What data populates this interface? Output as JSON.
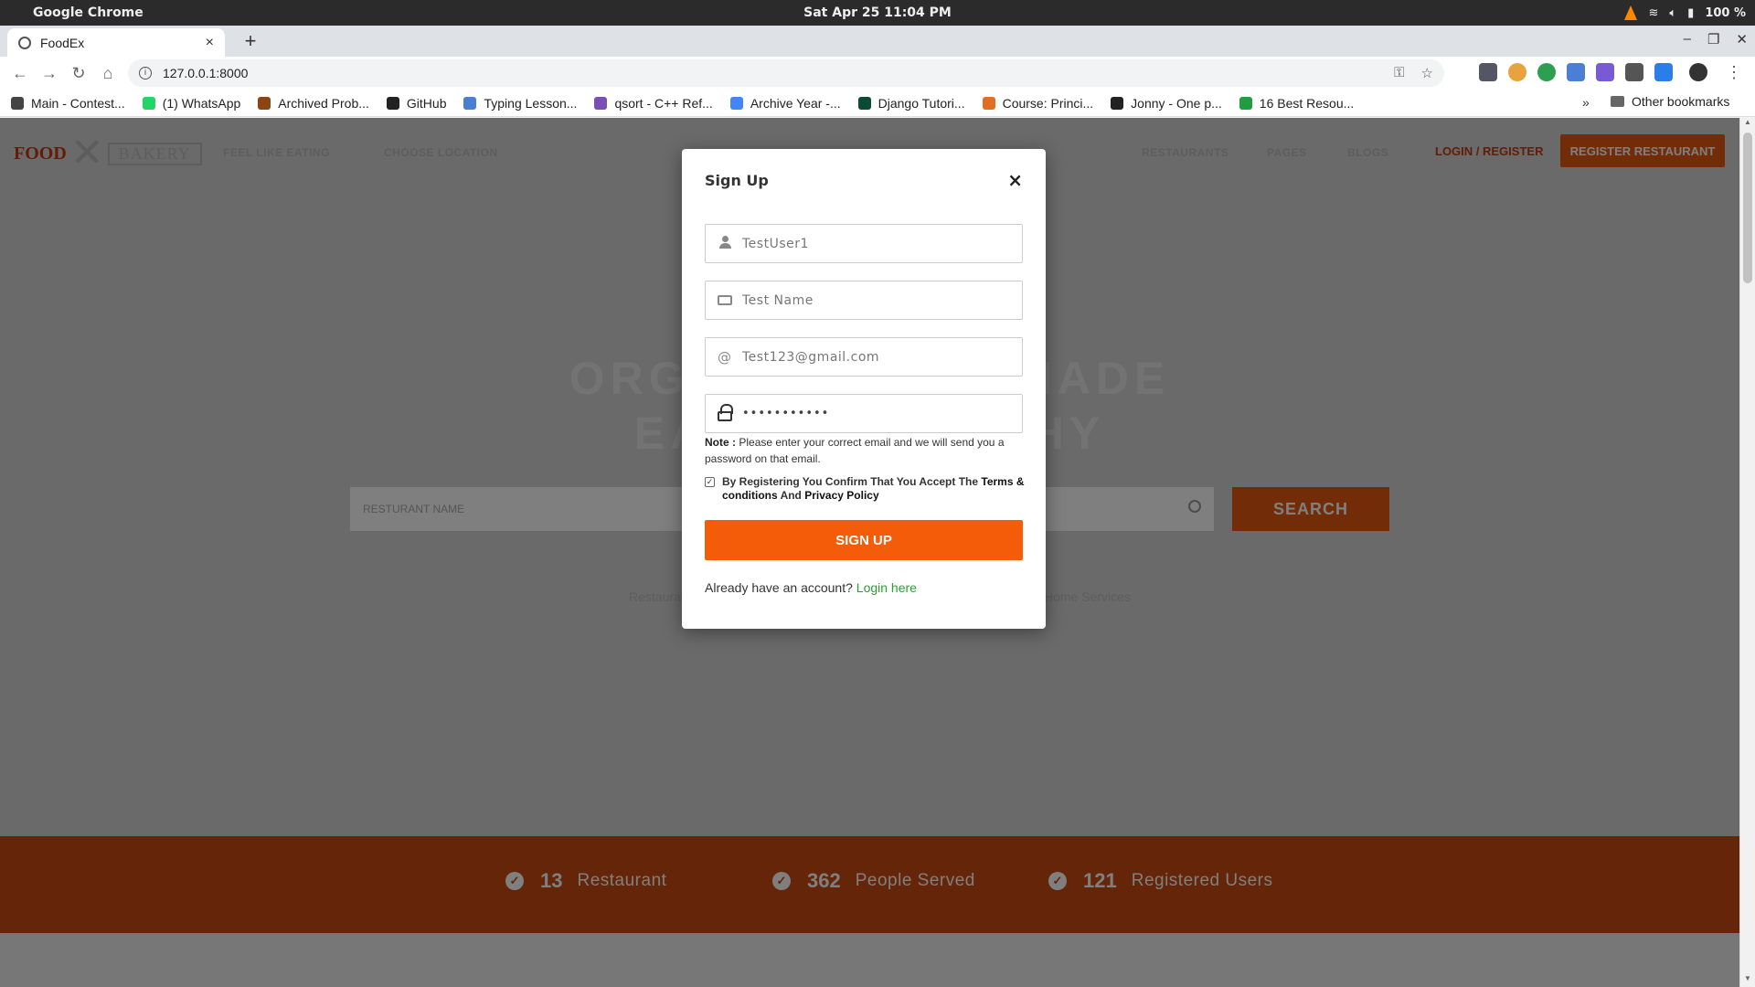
{
  "os": {
    "app_name": "Google Chrome",
    "clock": "Sat Apr 25  11:04 PM",
    "battery": "100 %"
  },
  "browser": {
    "tab_title": "FoodEx",
    "url": "127.0.0.1:8000",
    "bookmarks": [
      {
        "label": "Main - Contest...",
        "color": "#444444"
      },
      {
        "label": "(1) WhatsApp",
        "color": "#25d366"
      },
      {
        "label": "Archived Prob...",
        "color": "#8b4513"
      },
      {
        "label": "GitHub",
        "color": "#222222"
      },
      {
        "label": "Typing Lesson...",
        "color": "#4a7fd4"
      },
      {
        "label": "qsort - C++ Ref...",
        "color": "#7a4fb5"
      },
      {
        "label": "Archive Year -...",
        "color": "#4285f4"
      },
      {
        "label": "Django Tutori...",
        "color": "#0c4b33"
      },
      {
        "label": "Course: Princi...",
        "color": "#e07020"
      },
      {
        "label": "Jonny - One p...",
        "color": "#222222"
      },
      {
        "label": "16 Best Resou...",
        "color": "#1e9e3e"
      }
    ],
    "other_bookmarks": "Other bookmarks"
  },
  "site": {
    "logo_food": "FOOD",
    "logo_bakery": "BAKERY",
    "nav_feel": "FEEL LIKE EATING",
    "nav_location": "CHOOSE LOCATION",
    "nav_restaurants": "RESTAURANTS",
    "nav_pages": "PAGES",
    "nav_blogs": "BLOGS",
    "login_register": "LOGIN / REGISTER",
    "register_restaurant": "REGISTER RESTAURANT",
    "hero_line1": "ORGANIC FOOD MADE",
    "hero_line2": "EASY & HEALTHY",
    "search_placeholder": "RESTURANT NAME",
    "search_button": "SEARCH",
    "faded_left": "Restaurants",
    "faded_right": "Home Services",
    "stats": [
      {
        "num": "13",
        "label": "Restaurant"
      },
      {
        "num": "362",
        "label": "People Served"
      },
      {
        "num": "121",
        "label": "Registered Users"
      }
    ]
  },
  "modal": {
    "title": "Sign Up",
    "close": "×",
    "username": "TestUser1",
    "name": "Test Name",
    "email": "Test123@gmail.com",
    "password_mask": "•••••••••••",
    "note_label": "Note :",
    "note_text": "Please enter your correct email and we will send you a password on that email.",
    "terms_prefix": "By Registering You Confirm That You Accept The",
    "terms_link": "Terms & conditions",
    "terms_and": "And",
    "privacy_link": "Privacy Policy",
    "signup_button": "SIGN UP",
    "already_text": "Already have an account?",
    "login_link": "Login here"
  },
  "colors": {
    "accent": "#f45c0a",
    "stats_bg": "#c84a10",
    "login_link": "#27a12f"
  }
}
